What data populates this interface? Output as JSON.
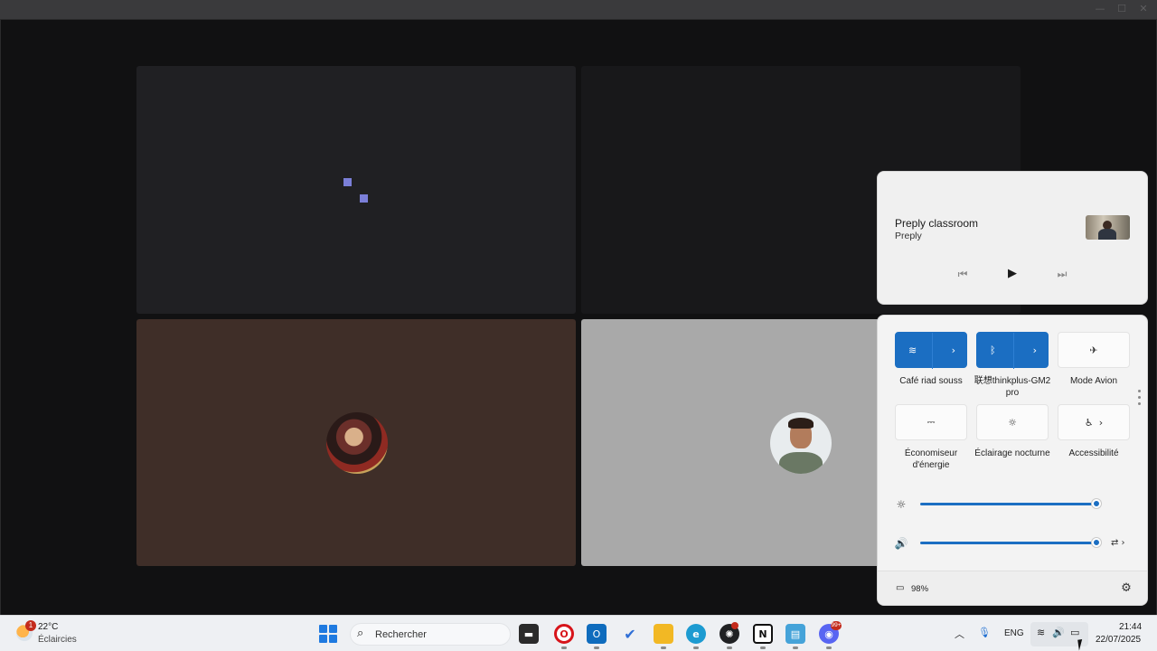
{
  "window": {
    "controls": {
      "minimize": "—",
      "maximize": "☐",
      "close": "✕"
    }
  },
  "media": {
    "title": "Preply classroom",
    "subtitle": "Preply",
    "controls": {
      "previous": "⏮",
      "play": "▶",
      "next": "⏭"
    }
  },
  "quick_settings": {
    "tiles": [
      {
        "label": "Café riad  souss",
        "icon": "wifi-icon",
        "glyph": "≋",
        "chevron": "›",
        "active": true
      },
      {
        "label": "联想thinkplus-GM2 pro",
        "icon": "bluetooth-icon",
        "glyph": "ᛒ",
        "chevron": "›",
        "active": true
      },
      {
        "label": "Mode Avion",
        "icon": "airplane-icon",
        "glyph": "✈",
        "active": false
      },
      {
        "label": "Économiseur d'énergie",
        "icon": "battery-saver-icon",
        "glyph": "⎓",
        "active": false
      },
      {
        "label": "Éclairage nocturne",
        "icon": "night-light-icon",
        "glyph": "☼",
        "active": false
      },
      {
        "label": "Accessibilité",
        "icon": "accessibility-icon",
        "glyph": "♿",
        "chevron": "›",
        "active": false
      }
    ],
    "brightness": {
      "icon": "brightness-icon",
      "glyph": "☼",
      "level": 1.0
    },
    "volume": {
      "icon": "volume-icon",
      "glyph": "🔊",
      "level": 1.0,
      "extra_glyph": "⇄ ›"
    },
    "battery": {
      "icon": "battery-icon",
      "glyph": "▭",
      "percent": "98%"
    },
    "settings_glyph": "⚙",
    "accent": "#1b6ec2"
  },
  "taskbar": {
    "weather": {
      "temp": "22°C",
      "desc": "Éclaircies",
      "badge": "1"
    },
    "search_placeholder": "Rechercher",
    "search_glyph": "⌕",
    "apps": [
      {
        "name": "file-explorer-dark-icon",
        "glyph": "▬",
        "color": "#2b2b2b"
      },
      {
        "name": "opera-icon",
        "glyph": "O",
        "color": "#d7141a"
      },
      {
        "name": "outlook-icon",
        "glyph": "O",
        "color": "#0f6cbd"
      },
      {
        "name": "todo-icon",
        "glyph": "✔",
        "color": "#2f6fd6"
      },
      {
        "name": "file-explorer-icon",
        "glyph": "▰",
        "color": "#f2b824"
      },
      {
        "name": "edge-icon",
        "glyph": "e",
        "color": "#1d9bd1"
      },
      {
        "name": "chatgpt-icon",
        "glyph": "✺",
        "color": "#202123"
      },
      {
        "name": "notion-icon",
        "glyph": "N",
        "color": "#1a1a1a"
      },
      {
        "name": "rdp-icon",
        "glyph": "▤",
        "color": "#45a3d9"
      },
      {
        "name": "discord-icon",
        "glyph": "◉",
        "color": "#5865f2"
      }
    ],
    "discord_badge": "99+",
    "tray": {
      "chevron_glyph": "︿",
      "mic_glyph": "🎙",
      "lang": "ENG",
      "wifi_glyph": "≋",
      "volume_glyph": "🔊",
      "battery_glyph": "▭"
    },
    "time": "21:44",
    "date": "22/07/2025"
  }
}
